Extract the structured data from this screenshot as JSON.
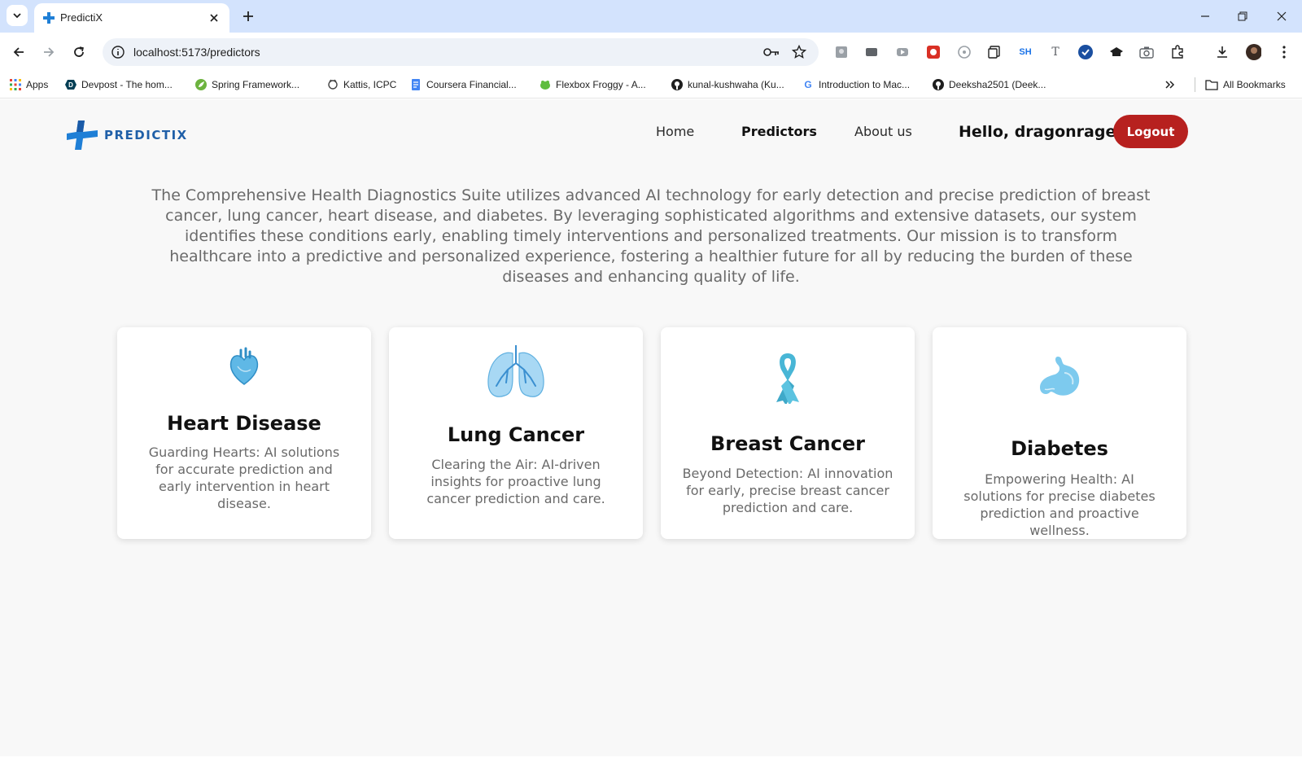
{
  "browser": {
    "tab_title": "PredictiX",
    "url": "localhost:5173/predictors",
    "bookmarks": [
      {
        "label": "Apps",
        "icon": "apps-grid-icon"
      },
      {
        "label": "Devpost - The hom...",
        "icon": "devpost-icon"
      },
      {
        "label": "Spring Framework...",
        "icon": "spring-icon"
      },
      {
        "label": "Kattis, ICPC",
        "icon": "kattis-icon"
      },
      {
        "label": "Coursera Financial...",
        "icon": "docs-icon"
      },
      {
        "label": "Flexbox Froggy - A...",
        "icon": "frog-icon"
      },
      {
        "label": "kunal-kushwaha (Ku...",
        "icon": "github-icon"
      },
      {
        "label": "Introduction to Mac...",
        "icon": "google-icon"
      },
      {
        "label": "Deeksha2501 (Deek...",
        "icon": "github-icon"
      }
    ],
    "all_bookmarks_label": "All Bookmarks",
    "extension_text": {
      "sh": "SH",
      "t": "T"
    }
  },
  "nav": {
    "logo_text": "PREDICTIX",
    "home": "Home",
    "predictors": "Predictors",
    "about": "About us",
    "greeting": "Hello, dragonrage",
    "logout": "Logout"
  },
  "intro": "The Comprehensive Health Diagnostics Suite utilizes advanced AI technology for early detection and precise prediction of breast cancer, lung cancer, heart disease, and diabetes. By leveraging sophisticated algorithms and extensive datasets, our system identifies these conditions early, enabling timely interventions and personalized treatments. Our mission is to transform healthcare into a predictive and personalized experience, fostering a healthier future for all by reducing the burden of these diseases and enhancing quality of life.",
  "cards": [
    {
      "title": "Heart Disease",
      "description": "Guarding Hearts: AI solutions for accurate prediction and early intervention in heart disease.",
      "icon": "heart-icon"
    },
    {
      "title": "Lung Cancer",
      "description": "Clearing the Air: AI-driven insights for proactive lung cancer prediction and care.",
      "icon": "lungs-icon"
    },
    {
      "title": "Breast Cancer",
      "description": "Beyond Detection: AI innovation for early, precise breast cancer prediction and care.",
      "icon": "ribbon-icon"
    },
    {
      "title": "Diabetes",
      "description": "Empowering Health: AI solutions for precise diabetes prediction and proactive wellness.",
      "icon": "stomach-icon"
    }
  ],
  "colors": {
    "accent": "#b7211f",
    "brand_blue": "#1f5fa8",
    "icon_blue": "#5fb8e6"
  }
}
